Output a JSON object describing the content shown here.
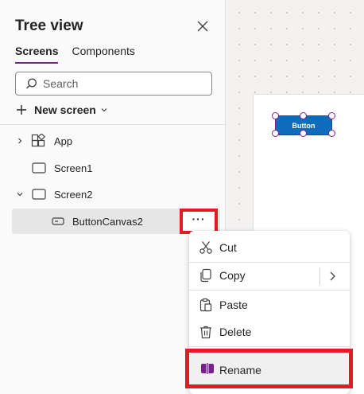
{
  "panel": {
    "title": "Tree view",
    "tabs": [
      {
        "label": "Screens",
        "active": true
      },
      {
        "label": "Components",
        "active": false
      }
    ],
    "search": {
      "placeholder": "Search",
      "value": ""
    },
    "new_screen_label": "New screen"
  },
  "tree": {
    "items": [
      {
        "label": "App",
        "icon": "app-icon"
      },
      {
        "label": "Screen1",
        "icon": "screen-icon"
      },
      {
        "label": "Screen2",
        "icon": "screen-icon"
      },
      {
        "label": "ButtonCanvas2",
        "icon": "button-control-icon"
      }
    ],
    "more_label": "···"
  },
  "canvas": {
    "button_label": "Button"
  },
  "context_menu": {
    "items": [
      {
        "label": "Cut",
        "icon": "scissors-icon"
      },
      {
        "label": "Copy",
        "icon": "copy-icon"
      },
      {
        "label": "Paste",
        "icon": "paste-icon"
      },
      {
        "label": "Delete",
        "icon": "trash-icon"
      },
      {
        "label": "Rename",
        "icon": "rename-icon"
      }
    ]
  },
  "colors": {
    "accent": "#7a1f8f",
    "highlight": "#e01b24",
    "canvas_button": "#0f6cbd"
  }
}
